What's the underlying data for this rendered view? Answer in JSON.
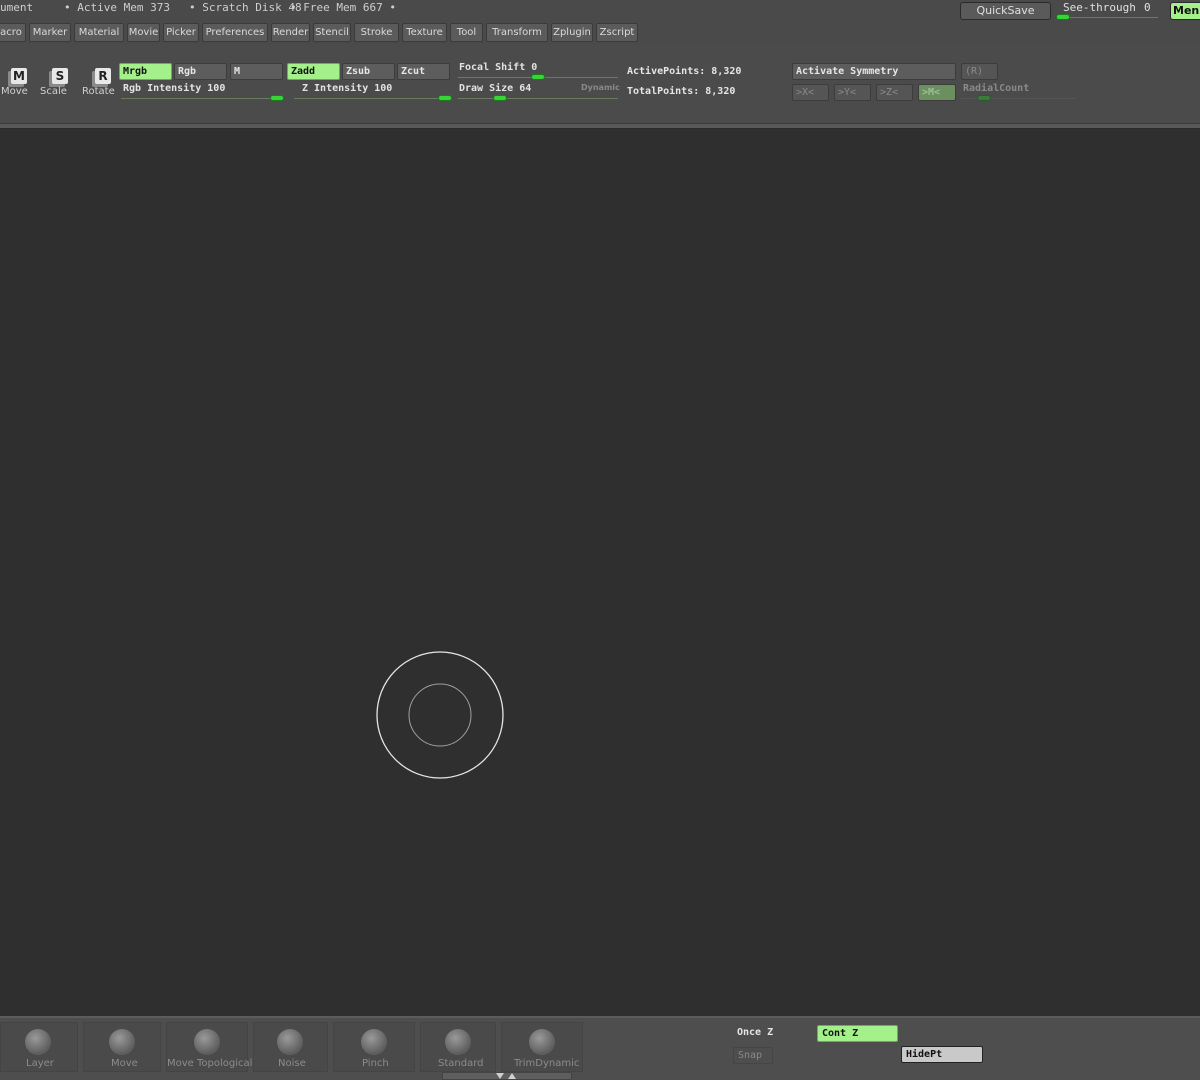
{
  "titlebar": {
    "document_fragment": "ument",
    "active_mem": "• Active Mem 373",
    "scratch_disk": "• Scratch Disk 48",
    "free_mem": "• Free Mem 667 •",
    "quicksave": "QuickSave",
    "see_through_label": "See-through",
    "see_through_value": "0",
    "menus": "Menus"
  },
  "menubar": {
    "items": [
      "acro",
      "Marker",
      "Material",
      "Movie",
      "Picker",
      "Preferences",
      "Render",
      "Stencil",
      "Stroke",
      "Texture",
      "Tool",
      "Transform",
      "Zplugin",
      "Zscript"
    ]
  },
  "topshelf": {
    "tools": [
      {
        "letter": "M",
        "label": "Move"
      },
      {
        "letter": "S",
        "label": "Scale"
      },
      {
        "letter": "R",
        "label": "Rotate"
      }
    ],
    "mrgb": "Mrgb",
    "rgb": "Rgb",
    "m": "M",
    "zadd": "Zadd",
    "zsub": "Zsub",
    "zcut": "Zcut",
    "rgb_intensity": "Rgb Intensity 100",
    "z_intensity": "Z Intensity 100",
    "focal_shift": "Focal Shift 0",
    "draw_size": "Draw Size 64",
    "dynamic": "Dynamic",
    "active_points": "ActivePoints: 8,320",
    "total_points": "TotalPoints: 8,320",
    "activate_symmetry": "Activate Symmetry",
    "r_label": "(R)",
    "sym_x": ">X<",
    "sym_y": ">Y<",
    "sym_z": ">Z<",
    "sym_m": ">M<",
    "radial_count": "RadialCount"
  },
  "bottomshelf": {
    "brushes": [
      "Layer",
      "Move",
      "Move Topological",
      "Noise",
      "Pinch",
      "Standard",
      "TrimDynamic"
    ],
    "once_z": "Once Z",
    "cont_z": "Cont Z",
    "snap": "Snap",
    "hidept": "HidePt"
  },
  "colors": {
    "accent_green": "#a4f08a",
    "slider_knob": "#37d437",
    "canvas": "#2f2f2f",
    "panel": "#4b4b4b"
  }
}
